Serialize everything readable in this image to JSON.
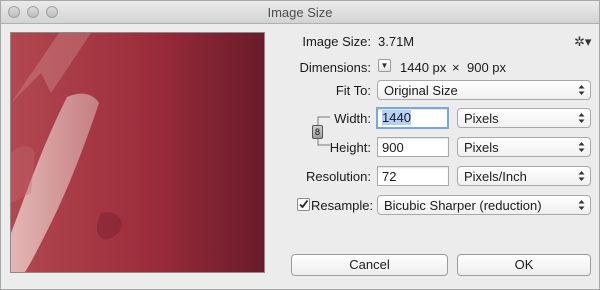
{
  "window": {
    "title": "Image Size"
  },
  "image_size": {
    "label": "Image Size:",
    "value": "3.71M"
  },
  "dimensions": {
    "label": "Dimensions:",
    "width": "1440 px",
    "times": "×",
    "height": "900 px"
  },
  "fit_to": {
    "label": "Fit To:",
    "value": "Original Size"
  },
  "width": {
    "label": "Width:",
    "value": "1440",
    "unit": "Pixels"
  },
  "height": {
    "label": "Height:",
    "value": "900",
    "unit": "Pixels"
  },
  "resolution": {
    "label": "Resolution:",
    "value": "72",
    "unit": "Pixels/Inch"
  },
  "resample": {
    "label": "Resample:",
    "checked": true,
    "value": "Bicubic Sharper (reduction)"
  },
  "buttons": {
    "cancel": "Cancel",
    "ok": "OK"
  },
  "icons": {
    "gear": "gear-icon",
    "chain": "chain-link-icon",
    "dimensions_menu": "dropdown-triangle-icon"
  },
  "colors": {
    "preview_base": "#9e2f3e",
    "focus_ring": "#7aa7dc"
  }
}
